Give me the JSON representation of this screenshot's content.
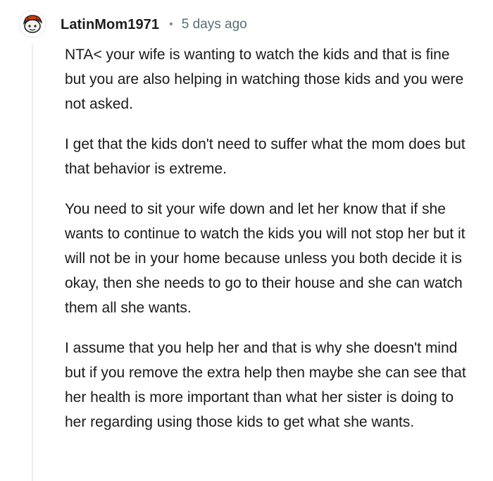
{
  "comment": {
    "author": "LatinMom1971",
    "separator": "•",
    "timestamp": "5 days ago",
    "paragraphs": [
      "NTA< your wife is wanting to watch the kids and that is fine but you are also helping in watching those kids and you were not asked.",
      "I get that the kids don't need to suffer what the mom does but that behavior is extreme.",
      "You need to sit your wife down and let her know that if she wants to continue to watch the kids you will not stop her but it will not be in your home because unless you both decide it is okay, then she needs to go to their house and she can watch them all she wants.",
      "I assume that you help her and that is why she doesn't mind but if you remove the extra help then maybe she can see that her health is more important than what her sister is doing to her regarding using those kids to get what she wants."
    ]
  },
  "icons": {
    "avatar": "snoo-avatar-icon"
  },
  "colors": {
    "text": "#1a1a1b",
    "meta": "#576f76",
    "thread_line": "#edeff1",
    "avatar_accent": "#d93a00"
  }
}
